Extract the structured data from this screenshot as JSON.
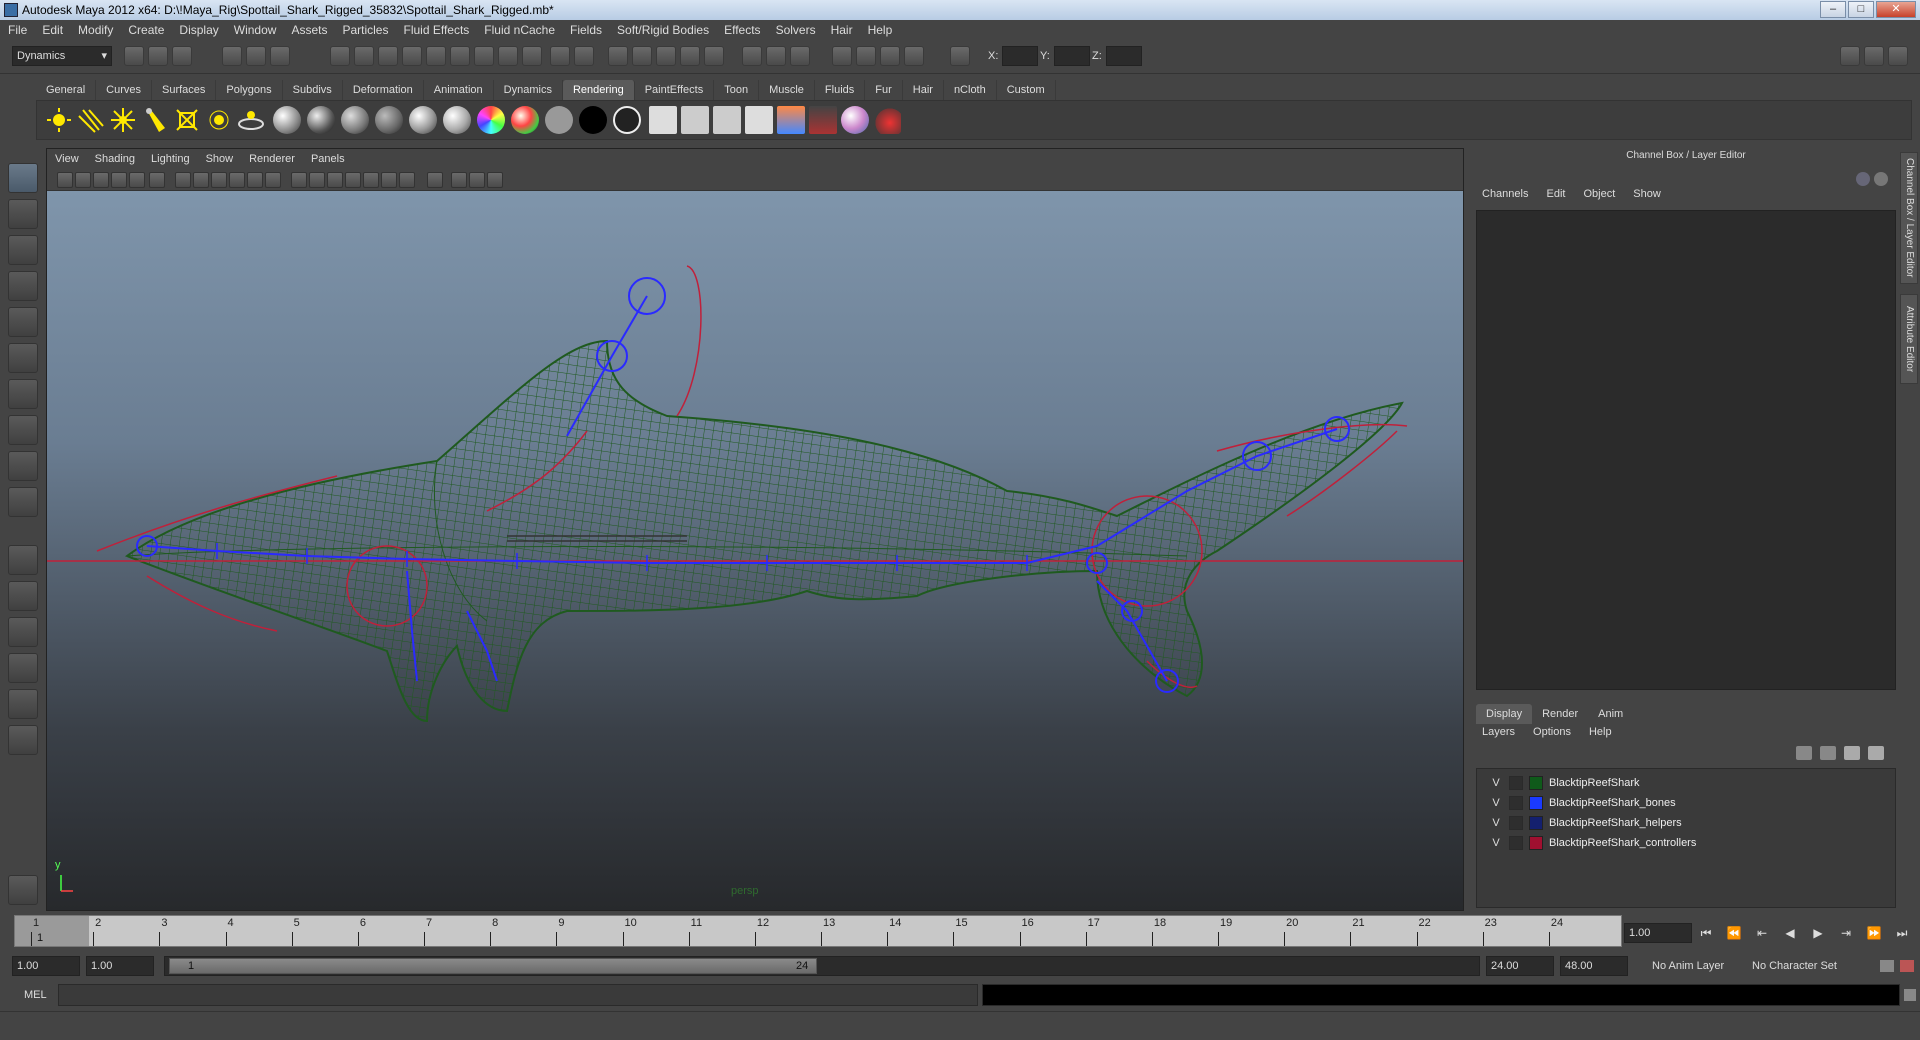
{
  "window": {
    "title": "Autodesk Maya 2012 x64: D:\\!Maya_Rig\\Spottail_Shark_Rigged_35832\\Spottail_Shark_Rigged.mb*"
  },
  "menubar": [
    "File",
    "Edit",
    "Modify",
    "Create",
    "Display",
    "Window",
    "Assets",
    "Particles",
    "Fluid Effects",
    "Fluid nCache",
    "Fields",
    "Soft/Rigid Bodies",
    "Effects",
    "Solvers",
    "Hair",
    "Help"
  ],
  "statusline": {
    "mode": "Dynamics",
    "x_label": "X:",
    "y_label": "Y:",
    "z_label": "Z:"
  },
  "shelf": {
    "tabs": [
      "General",
      "Curves",
      "Surfaces",
      "Polygons",
      "Subdivs",
      "Deformation",
      "Animation",
      "Dynamics",
      "Rendering",
      "PaintEffects",
      "Toon",
      "Muscle",
      "Fluids",
      "Fur",
      "Hair",
      "nCloth",
      "Custom"
    ],
    "active_tab": "Rendering"
  },
  "viewport": {
    "menu": [
      "View",
      "Shading",
      "Lighting",
      "Show",
      "Renderer",
      "Panels"
    ],
    "camera_label": "persp",
    "axis_y": "y",
    "colors": {
      "mesh": "#1f5a1f",
      "bones": "#2a2aff",
      "controllers": "#c0203a"
    }
  },
  "channel_box": {
    "title": "Channel Box / Layer Editor",
    "menu": [
      "Channels",
      "Edit",
      "Object",
      "Show"
    ],
    "layer_tabs": [
      "Display",
      "Render",
      "Anim"
    ],
    "active_layer_tab": "Display",
    "layer_menu": [
      "Layers",
      "Options",
      "Help"
    ],
    "layers": [
      {
        "visible": "V",
        "name": "BlacktipReefShark",
        "color": "#0f5a1a"
      },
      {
        "visible": "V",
        "name": "BlacktipReefShark_bones",
        "color": "#1a3aff"
      },
      {
        "visible": "V",
        "name": "BlacktipReefShark_helpers",
        "color": "#14206e"
      },
      {
        "visible": "V",
        "name": "BlacktipReefShark_controllers",
        "color": "#a01030"
      }
    ],
    "side_tabs": [
      "Channel Box / Layer Editor",
      "Attribute Editor"
    ]
  },
  "timeslider": {
    "ticks": [
      "1",
      "2",
      "3",
      "4",
      "5",
      "6",
      "7",
      "8",
      "9",
      "10",
      "11",
      "12",
      "13",
      "14",
      "15",
      "16",
      "17",
      "18",
      "19",
      "20",
      "21",
      "22",
      "23",
      "24"
    ],
    "current_frame": "1",
    "current_time": "1.00"
  },
  "range": {
    "start_time": "1.00",
    "playback_start": "1.00",
    "range_start_label": "1",
    "range_end_label": "24",
    "playback_end": "24.00",
    "end_time": "48.00",
    "anim_layer": "No Anim Layer",
    "character_set": "No Character Set"
  },
  "cmdline": {
    "label": "MEL"
  }
}
